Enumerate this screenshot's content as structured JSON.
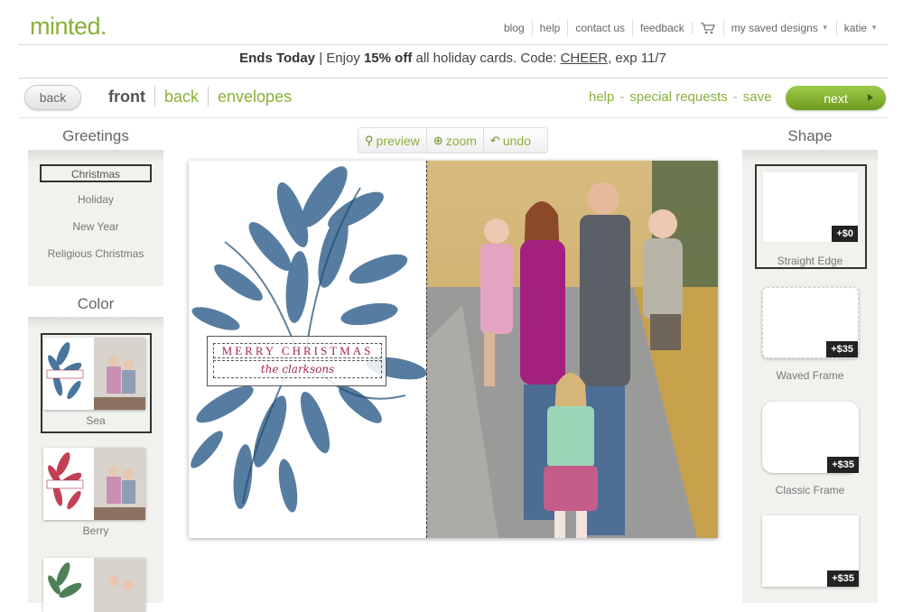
{
  "brand": {
    "logo": "minted."
  },
  "top_nav": {
    "items": [
      "blog",
      "help",
      "contact us",
      "feedback"
    ],
    "saved_designs": "my saved designs",
    "user": "katie"
  },
  "promo": {
    "lead": "Ends Today",
    "pre": "| Enjoy",
    "discount": "15% off",
    "mid": "all holiday cards. Code:",
    "code": "CHEER",
    "post": ", exp 11/7"
  },
  "editor_bar": {
    "back_label": "back",
    "views": [
      "front",
      "back",
      "envelopes"
    ],
    "links": [
      "help",
      "special requests",
      "save"
    ],
    "next_label": "next"
  },
  "toolbar": {
    "preview": "preview",
    "zoom": "zoom",
    "undo": "undo"
  },
  "greetings": {
    "title": "Greetings",
    "items": [
      "Christmas",
      "Holiday",
      "New Year",
      "Religious Christmas"
    ],
    "selected": "Christmas"
  },
  "color": {
    "title": "Color",
    "options": [
      {
        "label": "Sea",
        "accent": "#2a5f8c"
      },
      {
        "label": "Berry",
        "accent": "#b8203a"
      },
      {
        "label": "",
        "accent": "#2f6b3a"
      }
    ],
    "selected": "Sea"
  },
  "card": {
    "greeting": "MERRY CHRISTMAS",
    "family_name": "the clarksons",
    "leaf_color": "#2c5d8a"
  },
  "shape": {
    "title": "Shape",
    "options": [
      {
        "label": "Straight Edge",
        "price": "+$0"
      },
      {
        "label": "Waved Frame",
        "price": "+$35"
      },
      {
        "label": "Classic Frame",
        "price": "+$35"
      },
      {
        "label": "",
        "price": "+$35"
      }
    ],
    "selected": "Straight Edge"
  }
}
